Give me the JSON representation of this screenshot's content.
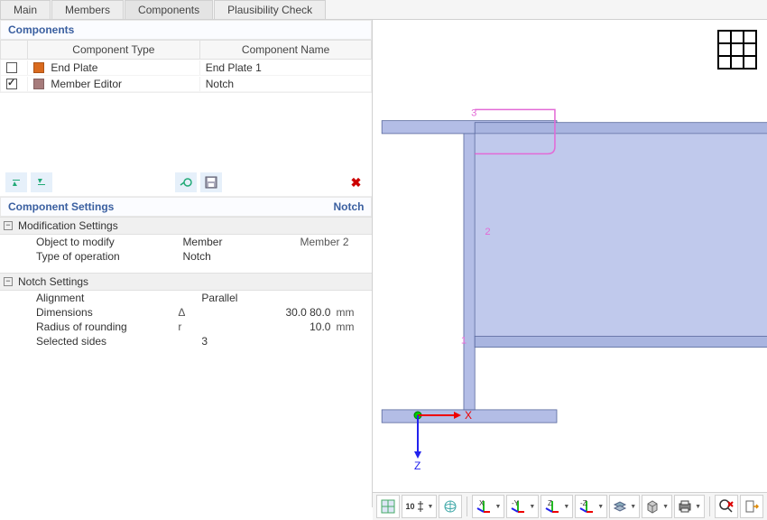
{
  "tabs": [
    "Main",
    "Members",
    "Components",
    "Plausibility Check"
  ],
  "active_tab": 2,
  "components_panel": {
    "title": "Components",
    "headers": {
      "type": "Component Type",
      "name": "Component Name"
    },
    "rows": [
      {
        "checked": false,
        "swatch": "#D96A1E",
        "type": "End Plate",
        "name": "End Plate 1"
      },
      {
        "checked": true,
        "swatch": "#A67B7B",
        "type": "Member Editor",
        "name": "Notch"
      }
    ]
  },
  "settings_panel": {
    "title_left": "Component Settings",
    "title_right": "Notch",
    "groups": [
      {
        "title": "Modification Settings",
        "rows": [
          {
            "label": "Object to modify",
            "sym": "",
            "val": "Member",
            "unit": "",
            "val2": "Member 2"
          },
          {
            "label": "Type of operation",
            "sym": "",
            "val": "Notch",
            "unit": "",
            "val2": ""
          }
        ]
      },
      {
        "title": "Notch Settings",
        "rows": [
          {
            "label": "Alignment",
            "sym": "",
            "val": "Parallel",
            "unit": "",
            "val2": ""
          },
          {
            "label": "Dimensions",
            "sym": "Δ",
            "val": "30.0 80.0",
            "unit": "mm",
            "val2": ""
          },
          {
            "label": "Radius of rounding",
            "sym": "r",
            "val": "10.0",
            "unit": "mm",
            "val2": ""
          },
          {
            "label": "Selected sides",
            "sym": "",
            "val": "3",
            "unit": "",
            "val2": ""
          }
        ]
      }
    ]
  },
  "viewer": {
    "axis_x": "X",
    "axis_y": "Z",
    "labels": [
      "1",
      "2",
      "3"
    ]
  },
  "bottom_toolbar": {
    "overlay_text": "10"
  }
}
